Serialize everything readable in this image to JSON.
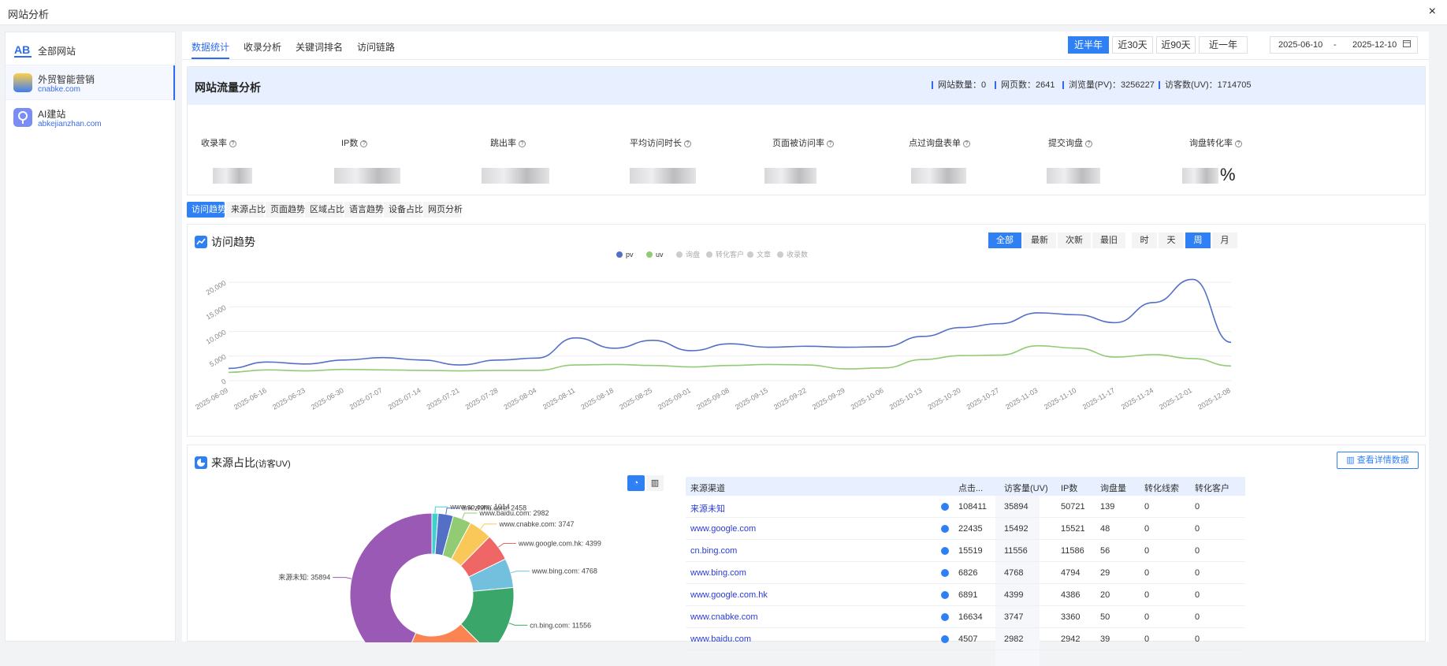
{
  "window": {
    "title": "网站分析",
    "close": "×"
  },
  "sidebar": {
    "items": [
      {
        "name": "全部网站",
        "domain": ""
      },
      {
        "name": "外贸智能营销",
        "domain": "cnabke.com"
      },
      {
        "name": "AI建站",
        "domain": "abkejianzhan.com"
      }
    ]
  },
  "tabs": [
    "数据统计",
    "收录分析",
    "关键词排名",
    "访问链路"
  ],
  "ranges": [
    "近半年",
    "近30天",
    "近90天",
    "近一年"
  ],
  "date": {
    "start": "2025-06-10",
    "sep": "-",
    "end": "2025-12-10"
  },
  "overview": {
    "title": "网站流量分析",
    "stats": [
      "网站数量：0",
      "网页数：2641",
      "浏览量(PV)：3256227",
      "访客数(UV)：1714705"
    ],
    "metrics": [
      "收录率",
      "IP数",
      "跳出率",
      "平均访问时长",
      "页面被访问率",
      "点过询盘表单",
      "提交询盘",
      "询盘转化率"
    ],
    "percent_sign": "%"
  },
  "subtabs": [
    "访问趋势",
    "来源占比",
    "页面趋势",
    "区域占比",
    "语言趋势",
    "设备占比",
    "网页分析"
  ],
  "trend": {
    "title": "访问趋势",
    "filters": [
      "全部",
      "最新",
      "次新",
      "最旧"
    ],
    "periods": [
      "时",
      "天",
      "周",
      "月"
    ],
    "legend": [
      {
        "name": "pv",
        "color": "#5470c6"
      },
      {
        "name": "uv",
        "color": "#91cc75"
      },
      {
        "name": "询盘",
        "color": "#cccccc"
      },
      {
        "name": "转化客户",
        "color": "#cccccc"
      },
      {
        "name": "文章",
        "color": "#cccccc"
      },
      {
        "name": "收录数",
        "color": "#cccccc"
      }
    ]
  },
  "source": {
    "title": "来源占比",
    "subtitle": "(访客UV)",
    "detail_button": "查看详情数据",
    "columns": [
      "来源渠道",
      "点击...",
      "访客量(UV)",
      "IP数",
      "询盘量",
      "转化线索",
      "转化客户"
    ],
    "rows": [
      [
        "来源未知",
        "108411",
        "35894",
        "50721",
        "139",
        "0",
        "0"
      ],
      [
        "www.google.com",
        "22435",
        "15492",
        "15521",
        "48",
        "0",
        "0"
      ],
      [
        "cn.bing.com",
        "15519",
        "11556",
        "11586",
        "56",
        "0",
        "0"
      ],
      [
        "www.bing.com",
        "6826",
        "4768",
        "4794",
        "29",
        "0",
        "0"
      ],
      [
        "www.google.com.hk",
        "6891",
        "4399",
        "4386",
        "20",
        "0",
        "0"
      ],
      [
        "www.cnabke.com",
        "16634",
        "3747",
        "3360",
        "50",
        "0",
        "0"
      ],
      [
        "www.baidu.com",
        "4507",
        "2982",
        "2942",
        "39",
        "0",
        "0"
      ]
    ],
    "pie_labels": [
      "www.so.com: 1014",
      "link.zhihu.com: 2458",
      "www.baidu.com: 2982",
      "www.cnabke.com: 3747",
      "www.google.com.hk: 4399",
      "www.bing.com: 4768",
      "cn.bing.com: 11556",
      "来源未知: 35894"
    ]
  },
  "chart_data": [
    {
      "type": "line",
      "x": [
        "2025-06-09",
        "2025-06-16",
        "2025-06-23",
        "2025-06-30",
        "2025-07-07",
        "2025-07-14",
        "2025-07-21",
        "2025-07-28",
        "2025-08-04",
        "2025-08-11",
        "2025-08-18",
        "2025-08-25",
        "2025-09-01",
        "2025-09-08",
        "2025-09-15",
        "2025-09-22",
        "2025-09-29",
        "2025-10-06",
        "2025-10-13",
        "2025-10-20",
        "2025-10-27",
        "2025-11-03",
        "2025-11-10",
        "2025-11-17",
        "2025-11-24",
        "2025-12-01",
        "2025-12-08"
      ],
      "series": [
        {
          "name": "pv",
          "values": [
            2500,
            3800,
            3400,
            4200,
            4700,
            4200,
            3200,
            4200,
            4600,
            8700,
            6600,
            8200,
            6100,
            7500,
            6800,
            7000,
            6800,
            6900,
            9000,
            10800,
            11600,
            13800,
            13400,
            11800,
            15900,
            20600,
            7800
          ]
        },
        {
          "name": "uv",
          "values": [
            1700,
            2200,
            2000,
            2300,
            2200,
            2100,
            2000,
            2100,
            2100,
            3200,
            3300,
            3100,
            2800,
            3100,
            3300,
            3200,
            2400,
            2600,
            4300,
            5100,
            5200,
            7100,
            6600,
            4800,
            5300,
            4500,
            3000
          ]
        }
      ],
      "ylim": [
        0,
        25000
      ],
      "yticks": [
        0,
        5000,
        10000,
        15000,
        20000
      ],
      "grid": true,
      "legend": "top-center"
    },
    {
      "type": "pie",
      "categories": [
        "来源未知",
        "www.google.com",
        "cn.bing.com",
        "www.bing.com",
        "www.google.com.hk",
        "www.cnabke.com",
        "www.baidu.com",
        "link.zhihu.com",
        "www.so.com"
      ],
      "values": [
        35894,
        15492,
        11556,
        4768,
        4399,
        3747,
        2982,
        2458,
        1014
      ]
    }
  ]
}
